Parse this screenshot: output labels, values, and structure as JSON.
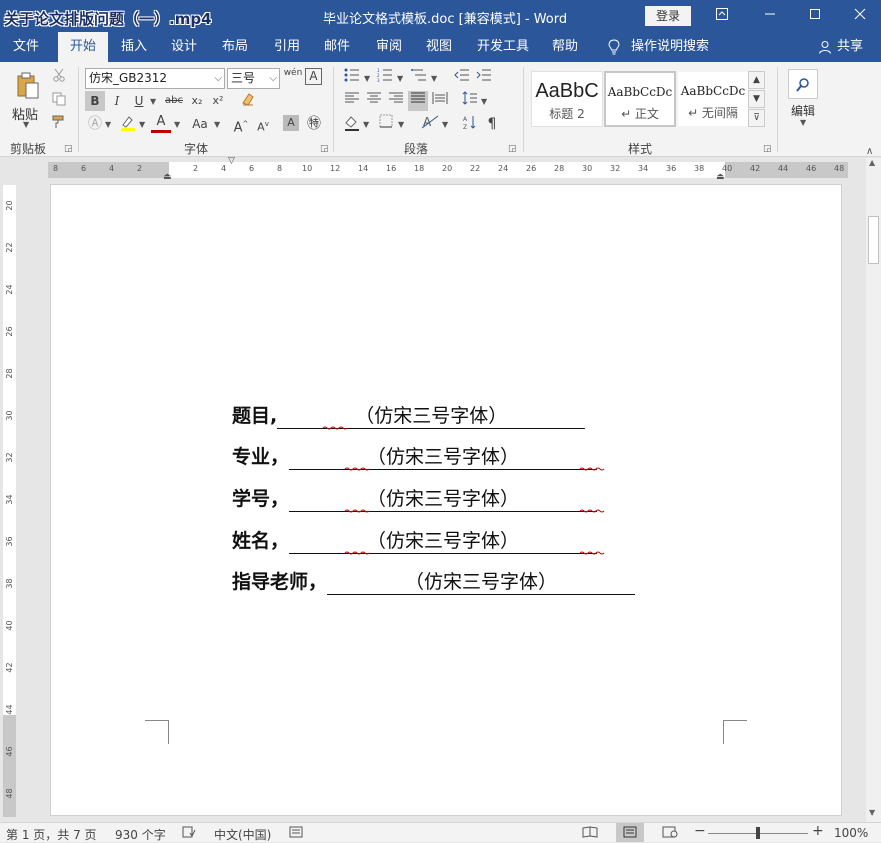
{
  "window": {
    "video_overlay": "关于论文排版问题（一）.mp4",
    "title": "毕业论文格式模板.doc [兼容模式]  -  Word",
    "login": "登录"
  },
  "menu": {
    "tabs": [
      "文件",
      "开始",
      "插入",
      "设计",
      "布局",
      "引用",
      "邮件",
      "审阅",
      "视图",
      "开发工具",
      "帮助"
    ],
    "search": "操作说明搜索",
    "share": "共享"
  },
  "ribbon": {
    "clipboard": {
      "paste": "粘贴",
      "label": "剪贴板"
    },
    "font": {
      "name": "仿宋_GB2312",
      "size": "三号",
      "label": "字体",
      "phonetic": "wén",
      "bold": "B",
      "italic": "I",
      "underline": "U",
      "strike": "abc",
      "sub": "x₂",
      "sup": "x²",
      "aa": "Aa",
      "grow": "A",
      "shrink": "A"
    },
    "paragraph": {
      "label": "段落"
    },
    "styles": {
      "label": "样式",
      "items": [
        {
          "sample": "AaBbC",
          "name": "标题 2"
        },
        {
          "sample": "AaBbCcDc",
          "name": "↵ 正文"
        },
        {
          "sample": "AaBbCcDc",
          "name": "↵ 无间隔"
        }
      ]
    },
    "editing": {
      "label": "编辑"
    }
  },
  "ruler": {
    "h_ticks": [
      "8",
      "6",
      "4",
      "2",
      "2",
      "4",
      "6",
      "8",
      "10",
      "12",
      "14",
      "16",
      "18",
      "20",
      "22",
      "24",
      "26",
      "28",
      "30",
      "32",
      "34",
      "36",
      "38",
      "40",
      "42",
      "44",
      "46",
      "48"
    ],
    "v_ticks": [
      "20",
      "22",
      "24",
      "26",
      "28",
      "30",
      "32",
      "34",
      "36",
      "38",
      "40",
      "42",
      "44",
      "46",
      "48"
    ]
  },
  "document": {
    "lines": [
      {
        "label": "题目,",
        "hint": "（仿宋三号字体）"
      },
      {
        "label": "专业，",
        "hint": "（仿宋三号字体）"
      },
      {
        "label": "学号，",
        "hint": "（仿宋三号字体）"
      },
      {
        "label": "姓名，",
        "hint": "（仿宋三号字体）"
      },
      {
        "label": "指导老师，",
        "hint": "（仿宋三号字体）"
      }
    ]
  },
  "status": {
    "pages": "第 1 页，共 7 页",
    "words": "930 个字",
    "language": "中文(中国)",
    "zoom": "100%"
  },
  "colors": {
    "accent": "#2b579a",
    "ribbon": "#f3f3f3"
  }
}
